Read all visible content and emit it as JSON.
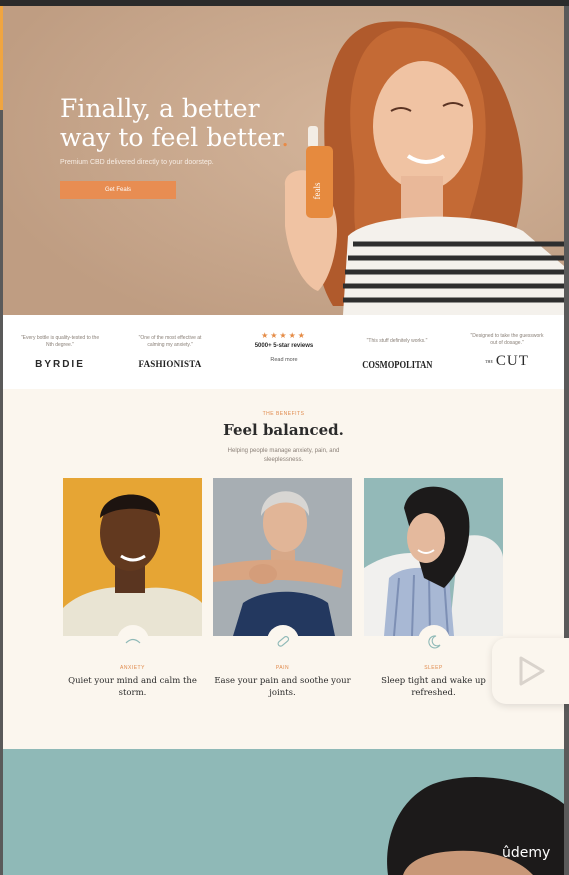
{
  "hero": {
    "title": "Finally, a better way to feel better",
    "title_dot": ".",
    "subtitle": "Premium CBD delivered directly to your doorstep.",
    "cta": "Get Feals",
    "bottle_label": "feals"
  },
  "press": {
    "items": [
      {
        "quote": "\"Every bottle is quality-tested to the Nth degree.\"",
        "logo": "BYRDIE"
      },
      {
        "quote": "\"One of the most effective at calming my anxiety.\"",
        "logo": "FASHIONISTA"
      },
      {
        "stars": "★★★★★",
        "reviews": "5000+ 5-star reviews",
        "link": "Read more"
      },
      {
        "quote": "\"This stuff definitely works.\"",
        "logo": "COSMOPOLITAN"
      },
      {
        "quote": "\"Designed to take the guesswork out of dosage.\"",
        "logo_small": "THE",
        "logo": "CUT"
      }
    ]
  },
  "benefits": {
    "eyebrow": "THE BENEFITS",
    "title": "Feel balanced.",
    "subtitle": "Helping people manage anxiety, pain, and sleeplessness.",
    "cards": [
      {
        "category": "ANXIETY",
        "text": "Quiet your mind and calm the storm.",
        "icon": "wave-icon"
      },
      {
        "category": "PAIN",
        "text": "Ease your pain and soothe your joints.",
        "icon": "bandage-icon"
      },
      {
        "category": "SLEEP",
        "text": "Sleep tight and wake up refreshed.",
        "icon": "moon-icon"
      }
    ]
  },
  "watermark": "ûdemy",
  "colors": {
    "accent": "#e88d52",
    "hero_bg": "#c9a98f",
    "page_bg": "#fbf6ee",
    "teal": "#8fb9b7"
  }
}
